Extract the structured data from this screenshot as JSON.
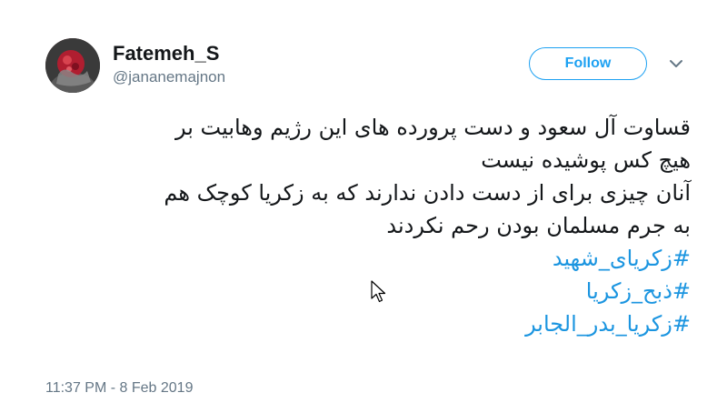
{
  "tweet": {
    "display_name": "Fatemeh_S",
    "handle": "@jananemajnon",
    "follow_label": "Follow",
    "text_lines": [
      "قساوت آل سعود و دست پرورده های این رژیم وهابیت بر",
      "هیچ کس پوشیده نیست",
      "آنان چیزی برای از دست دادن ندارند که به زکریا کوچک هم",
      "به جرم مسلمان بودن رحم نکردند"
    ],
    "hashtags": [
      "#زکریای_شهید",
      "#ذبح_زکریا",
      "#زکریا_بدر_الجابر"
    ],
    "timestamp": "11:37 PM - 8 Feb 2019"
  },
  "colors": {
    "accent": "#1da1f2",
    "hashtag": "#1b95e0",
    "secondary_text": "#657786",
    "primary_text": "#14171a"
  },
  "icons": {
    "caret": "chevron-down-icon",
    "pointer": "mouse-cursor-icon"
  }
}
